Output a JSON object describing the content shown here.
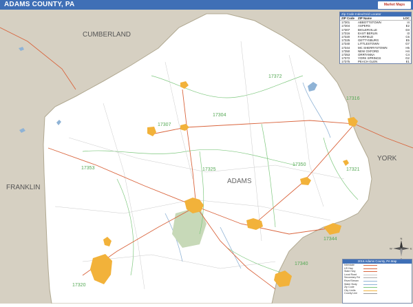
{
  "title": "ADAMS COUNTY, PA",
  "logo_text": "Market Maps",
  "region_labels": {
    "cumberland": "CUMBERLAND",
    "franklin": "FRANKLIN",
    "york": "YORK",
    "adams": "ADAMS"
  },
  "zip_labels": [
    {
      "id": "17372",
      "text": "17372"
    },
    {
      "id": "17304",
      "text": "17304"
    },
    {
      "id": "17307",
      "text": "17307"
    },
    {
      "id": "17353",
      "text": "17353"
    },
    {
      "id": "17325",
      "text": "17325"
    },
    {
      "id": "17350",
      "text": "17350"
    },
    {
      "id": "17321",
      "text": "17321"
    },
    {
      "id": "17316",
      "text": "17316"
    },
    {
      "id": "17344",
      "text": "17344"
    },
    {
      "id": "17340",
      "text": "17340"
    },
    {
      "id": "17320",
      "text": "17320"
    }
  ],
  "zip_table": {
    "header": "Zip Code Index/Grid Locator",
    "columns": [
      "ZIP Code",
      "ZIP Name",
      "LOC"
    ],
    "rows": [
      [
        "17301",
        "ABBOTTSTOWN",
        "I4"
      ],
      [
        "17304",
        "ASPERS",
        "E2"
      ],
      [
        "17307",
        "BIGLERVILLE",
        "D3"
      ],
      [
        "17316",
        "EAST BERLIN",
        "I3"
      ],
      [
        "17320",
        "FAIRFIELD",
        "C6"
      ],
      [
        "17325",
        "GETTYSBURG",
        "E5"
      ],
      [
        "17340",
        "LITTLESTOWN",
        "G7"
      ],
      [
        "17344",
        "MC SHERRYSTOWN",
        "H5"
      ],
      [
        "17350",
        "NEW OXFORD",
        "H4"
      ],
      [
        "17353",
        "ORRTANNA",
        "C4"
      ],
      [
        "17372",
        "YORK SPRINGS",
        "G2"
      ],
      [
        "17375",
        "PEACH GLEN",
        "E1"
      ]
    ]
  },
  "map_key": {
    "title": "2016 Adams County, PA Map",
    "rows": [
      "Interstate",
      "US Hwy",
      "State Hwy",
      "Local Road",
      "Secondary Rd",
      "River/Stream",
      "Water Body",
      "Zip Code",
      "City Limits",
      "County Line"
    ]
  },
  "compass": {
    "n": "N",
    "s": "S",
    "e": "E",
    "w": "W"
  },
  "colors": {
    "title_bar": "#3f6fb6",
    "neighbor": "#d6d0c2",
    "county": "#ffffff",
    "urban": "#f2b23a",
    "park": "#c7d9b8",
    "water": "#8fb3d6",
    "highway": "#d9633b",
    "zip_boundary": "#7ec87e",
    "zip_text": "#53a853"
  }
}
